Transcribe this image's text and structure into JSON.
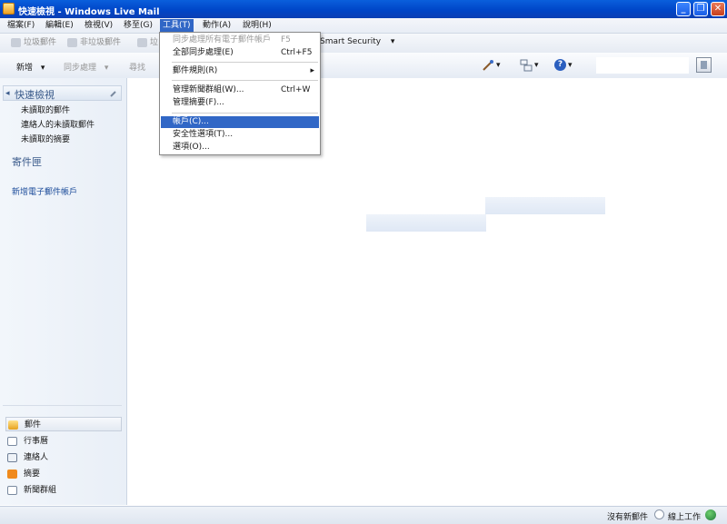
{
  "window": {
    "title": "快速檢視 - Windows Live Mail",
    "min_glyph": "_",
    "max_glyph": "❐",
    "close_glyph": "✕"
  },
  "menubar": {
    "items": [
      "檔案(F)",
      "編輯(E)",
      "檢視(V)",
      "移至(G)",
      "工具(T)",
      "動作(A)",
      "說明(H)"
    ],
    "active_index": 4
  },
  "toolbar_top": {
    "junk_label": "垃圾郵件",
    "not_junk_label": "非垃圾郵件",
    "partial_label": "垃",
    "security_label": "Smart Security",
    "security_caret": "▾"
  },
  "toolbar_main": {
    "new_label": "新增",
    "new_caret": "▾",
    "sync_label": "同步處理",
    "sync_caret": "▾",
    "find_label": "尋找",
    "help_glyph": "?",
    "caret": "▾"
  },
  "tools_menu": {
    "items": [
      {
        "label": "同步處理所有電子郵件帳戶",
        "shortcut": "F5",
        "disabled": true
      },
      {
        "label": "全部同步處理(E)",
        "shortcut": "Ctrl+F5"
      },
      {
        "label": "郵件規則(R)",
        "submenu_glyph": "▸"
      },
      {
        "label": "管理新聞群組(W)...",
        "shortcut": "Ctrl+W"
      },
      {
        "label": "管理摘要(F)..."
      },
      {
        "label": "帳戶(C)...",
        "highlighted": true
      },
      {
        "label": "安全性選項(T)..."
      },
      {
        "label": "選項(O)..."
      }
    ]
  },
  "sidebar": {
    "quick_views_title": "快速檢視",
    "collapse_glyph": "◂",
    "quick_views": [
      "未讀取的郵件",
      "連絡人的未讀取郵件",
      "未讀取的摘要"
    ],
    "outbox": "寄件匣",
    "add_account": "新增電子郵件帳戶",
    "nav": [
      {
        "label": "郵件",
        "icon": "mail-icon",
        "selected": true
      },
      {
        "label": "行事曆",
        "icon": "calendar-icon"
      },
      {
        "label": "連絡人",
        "icon": "contacts-icon"
      },
      {
        "label": "摘要",
        "icon": "feeds-icon"
      },
      {
        "label": "新聞群組",
        "icon": "newsgroups-icon"
      }
    ]
  },
  "statusbar": {
    "no_new_mail": "沒有新郵件",
    "online": "線上工作"
  },
  "colors": {
    "title_blue": "#0046c8",
    "menu_highlight": "#3167c6",
    "link_blue": "#1c4c9a"
  }
}
